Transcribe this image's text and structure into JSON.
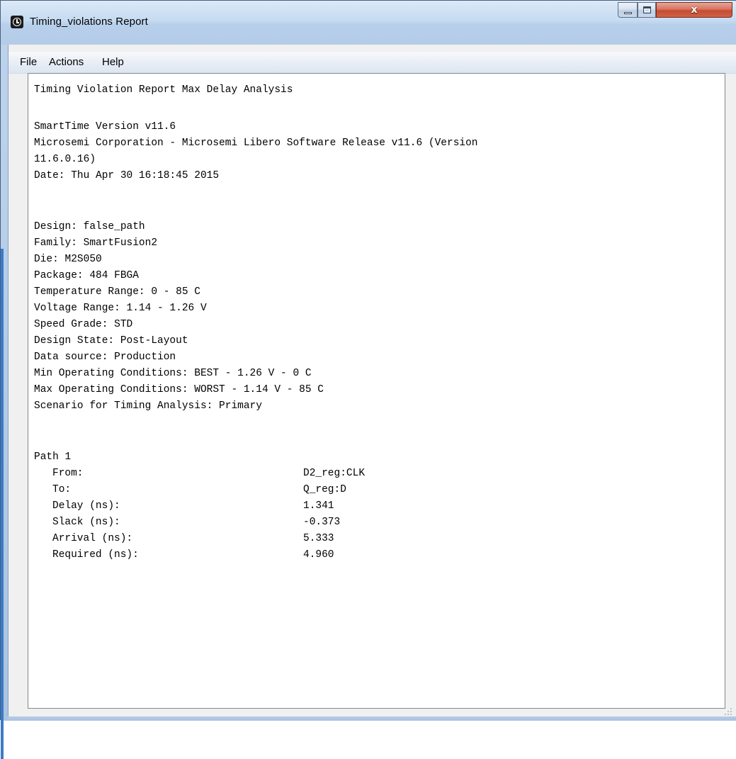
{
  "window": {
    "title": "Timing_violations Report",
    "icon": "clock-icon",
    "controls": {
      "minimize_icon": "minimize-icon",
      "maximize_icon": "maximize-icon",
      "close_icon": "close-icon",
      "close_glyph": "x"
    }
  },
  "menubar": {
    "items": [
      {
        "label": "File"
      },
      {
        "label": "Actions"
      },
      {
        "label": "Help"
      }
    ]
  },
  "report": {
    "header": "Timing Violation Report Max Delay Analysis",
    "version_line": "SmartTime Version v11.6",
    "vendor_line_1": "Microsemi Corporation - Microsemi Libero Software Release v11.6 (Version",
    "vendor_line_2": "11.6.0.16)",
    "date_line": "Date: Thu Apr 30 16:18:45 2015",
    "design_info": [
      "Design: false_path",
      "Family: SmartFusion2",
      "Die: M2S050",
      "Package: 484 FBGA",
      "Temperature Range: 0 - 85 C",
      "Voltage Range: 1.14 - 1.26 V",
      "Speed Grade: STD",
      "Design State: Post-Layout",
      "Data source: Production",
      "Min Operating Conditions: BEST - 1.26 V - 0 C",
      "Max Operating Conditions: WORST - 1.14 V - 85 C",
      "Scenario for Timing Analysis: Primary"
    ],
    "path": {
      "title": "Path 1",
      "rows": [
        {
          "label": "From:",
          "value": "D2_reg:CLK"
        },
        {
          "label": "To:",
          "value": "Q_reg:D"
        },
        {
          "label": "Delay (ns):",
          "value": "1.341"
        },
        {
          "label": "Slack (ns):",
          "value": "-0.373"
        },
        {
          "label": "Arrival (ns):",
          "value": "5.333"
        },
        {
          "label": "Required (ns):",
          "value": "4.960"
        }
      ]
    }
  },
  "colors": {
    "title_bar": "#c6dbf1",
    "close_button": "#c44c31",
    "client_background": "#f0f0f0",
    "text_area_background": "#ffffff"
  }
}
